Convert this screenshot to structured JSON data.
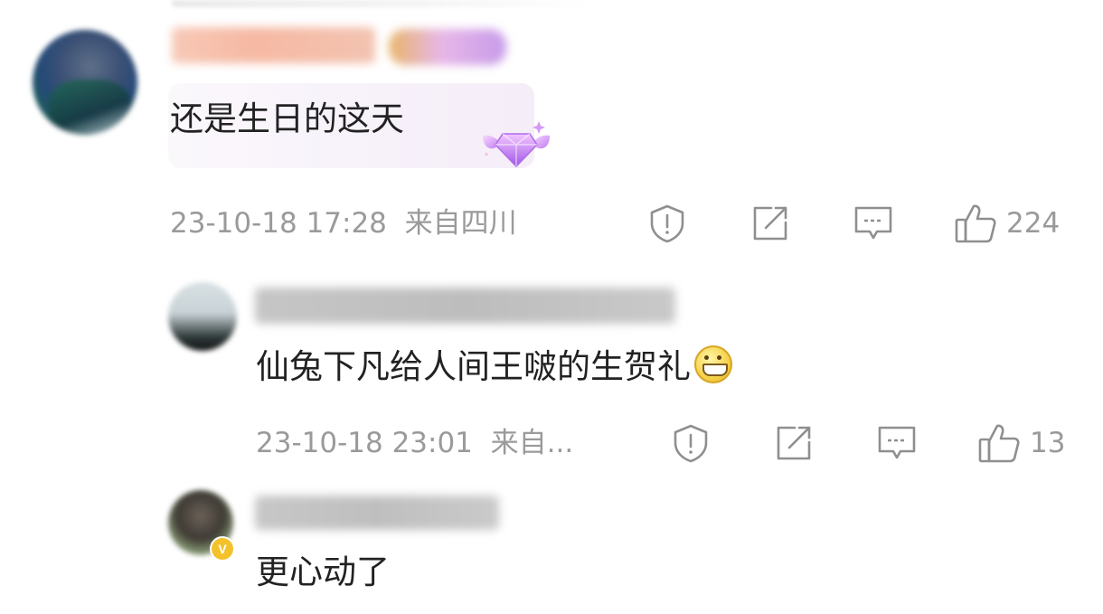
{
  "comments": [
    {
      "text": "还是生日的这天",
      "timestamp": "23-10-18 17:28",
      "location": "来自四川",
      "likes": "224",
      "badge_icon": "diamond-wings-icon"
    },
    {
      "text": "仙兔下凡给人间王啵的生贺礼",
      "emoji": "grin-emoji",
      "timestamp": "23-10-18 23:01",
      "location": "来自...",
      "likes": "13"
    },
    {
      "text": "更心动了",
      "verified_badge": "V"
    }
  ],
  "colors": {
    "text": "#222222",
    "meta": "#9a9a9a",
    "icon": "#8f8f8f",
    "bubble": "#f7f1fa",
    "verified": "#f3c22b"
  }
}
